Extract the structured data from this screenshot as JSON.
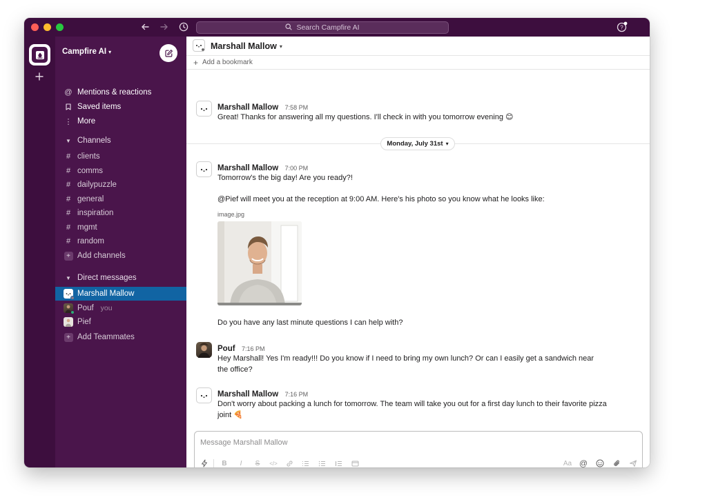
{
  "titlebar": {
    "search_placeholder": "Search Campfire AI",
    "back_icon": "arrow-left-icon",
    "forward_icon": "arrow-right-icon",
    "history_icon": "clock-icon",
    "help_icon": "help-icon"
  },
  "workspace": {
    "name": "Campfire AI",
    "compose_icon": "compose-icon"
  },
  "sidebar": {
    "top_items": [
      {
        "label": "Mentions & reactions",
        "icon": "at-icon"
      },
      {
        "label": "Saved items",
        "icon": "bookmark-icon"
      },
      {
        "label": "More",
        "icon": "more-vertical-icon"
      }
    ],
    "channels_header": "Channels",
    "channels": [
      "clients",
      "comms",
      "dailypuzzle",
      "general",
      "inspiration",
      "mgmt",
      "random"
    ],
    "add_channels": "Add channels",
    "dm_header": "Direct messages",
    "dms": [
      {
        "name": "Marshall Mallow",
        "active": true
      },
      {
        "name": "Pouf",
        "tag": "you"
      },
      {
        "name": "Pief"
      }
    ],
    "add_teammates": "Add Teammates"
  },
  "channel": {
    "name": "Marshall Mallow",
    "add_bookmark": "Add a bookmark"
  },
  "messages": [
    {
      "author": "Marshall Mallow",
      "time": "7:58 PM",
      "lines": [
        "Great! Thanks for answering all my questions. I'll check in with you tomorrow evening 😊"
      ]
    },
    {
      "author": "Marshall Mallow",
      "time": "7:00 PM",
      "lines": [
        "Tomorrow's the big day! Are you ready?!",
        "@Pief will meet you at the reception at 9:00 AM. Here's his photo so you know what he looks like:"
      ],
      "file": "image.jpg",
      "after": "Do you have any last minute questions I can help with?"
    },
    {
      "author": "Pouf",
      "time": "7:16 PM",
      "lines": [
        "Hey Marshall! Yes I'm ready!!! Do you know if I need to bring my own lunch? Or can I easily get a sandwich near the office?"
      ]
    },
    {
      "author": "Marshall Mallow",
      "time": "7:16 PM",
      "lines": [
        "Don't worry about packing a lunch for tomorrow. The team will take you out for a first day lunch to their favorite pizza joint 🍕"
      ]
    }
  ],
  "date_divider": "Monday, July 31st",
  "composer": {
    "placeholder": "Message Marshall Mallow",
    "format_label": "Aa"
  },
  "colors": {
    "aubergine": "#4a154b",
    "aubergine_dark": "#3d0e3e",
    "active_blue": "#1164a3"
  }
}
